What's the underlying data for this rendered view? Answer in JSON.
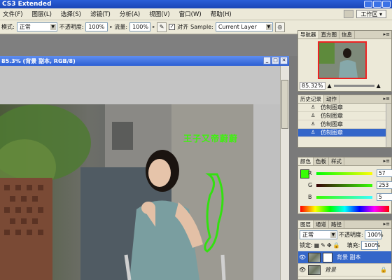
{
  "app_title": "CS3 Extended",
  "menu": [
    "文件(F)",
    "图层(L)",
    "选择(S)",
    "滤镜(T)",
    "分析(A)",
    "视图(V)",
    "窗口(W)",
    "帮助(H)"
  ],
  "workspace_label": "工作区",
  "options": {
    "mode_label": "模式:",
    "mode_value": "正常",
    "opacity_label": "不透明度:",
    "opacity_value": "100%",
    "flow_label": "流量:",
    "flow_value": "100%",
    "aligned_label": "对齐",
    "sample_label": "Sample:",
    "sample_value": "Current Layer"
  },
  "document": {
    "title": "85.3% (背景 副本, RGB/8)",
    "overlay_text": "王子又帝蔚蔚"
  },
  "navigator": {
    "tabs": [
      "导航器",
      "直方图",
      "信息"
    ],
    "zoom": "85.32%"
  },
  "history": {
    "tabs": [
      "历史记录",
      "动作"
    ],
    "items": [
      "仿制图章",
      "仿制图章",
      "仿制图章",
      "仿制图章"
    ]
  },
  "color_panel": {
    "tabs": [
      "颜色",
      "色板",
      "样式"
    ],
    "r_label": "R",
    "r_value": "57",
    "g_label": "G",
    "g_value": "253",
    "b_label": "B",
    "b_value": "5",
    "foreground": "#39fd05"
  },
  "layers": {
    "tabs": [
      "图层",
      "通道",
      "路径"
    ],
    "blend_mode": "正常",
    "opacity_label": "不透明度:",
    "opacity_value": "100%",
    "lock_label": "锁定:",
    "fill_label": "填充:",
    "fill_value": "100%",
    "items": [
      "背景 副本",
      "背景"
    ]
  }
}
